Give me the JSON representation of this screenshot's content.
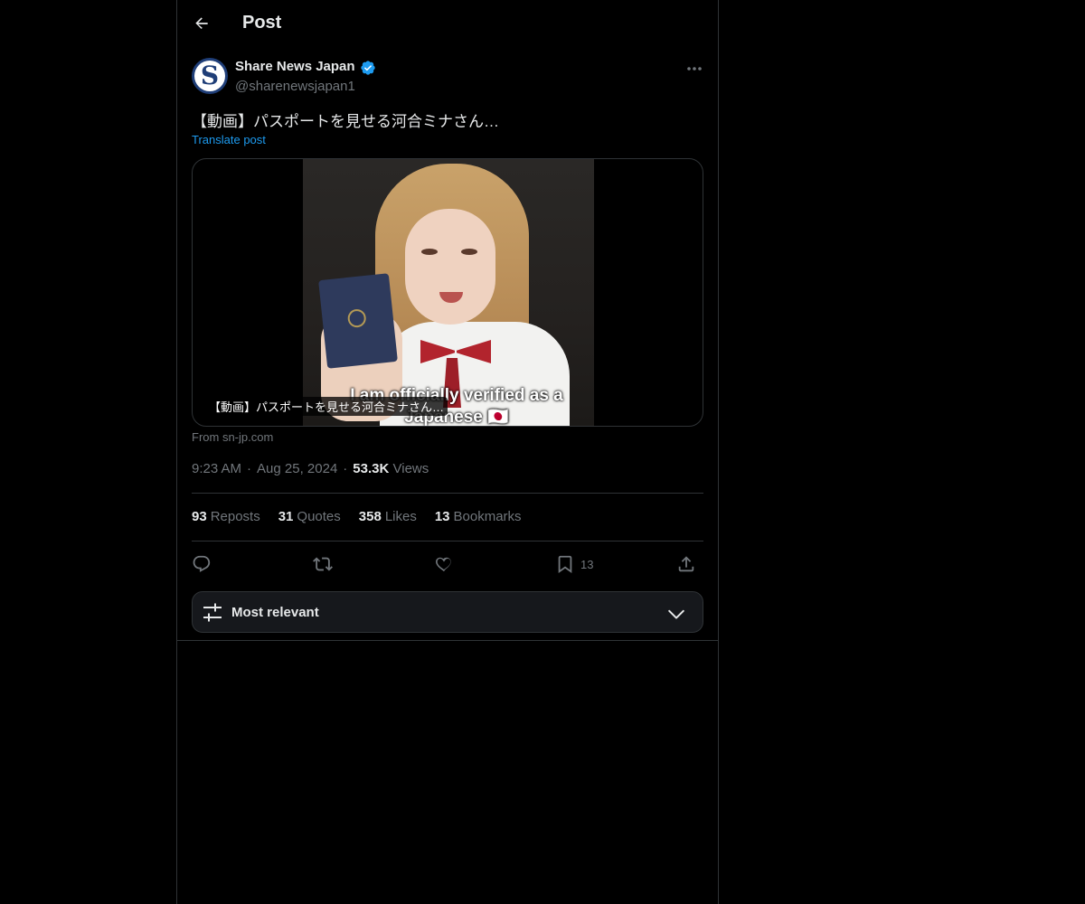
{
  "header": {
    "title": "Post",
    "back_icon": "arrow-left-icon"
  },
  "post": {
    "author": {
      "name": "Share News Japan",
      "handle": "@sharenewsjapan1",
      "avatar_letter": "S",
      "verified": true
    },
    "text": "【動画】パスポートを見せる河合ミナさん…",
    "translate_label": "Translate post",
    "media": {
      "caption": "【動画】パスポートを見せる河合ミナさん…",
      "subtitle": "I am officially verified as a Japanese 🇯🇵",
      "source": "From sn-jp.com"
    },
    "time": "9:23 AM",
    "date": "Aug 25, 2024",
    "views_count": "53.3K",
    "views_label": "Views"
  },
  "stats": {
    "reposts": {
      "count": "93",
      "label": "Reposts"
    },
    "quotes": {
      "count": "31",
      "label": "Quotes"
    },
    "likes": {
      "count": "358",
      "label": "Likes"
    },
    "bookmarks": {
      "count": "13",
      "label": "Bookmarks"
    }
  },
  "actions": {
    "bookmark_count": "13"
  },
  "sort": {
    "label": "Most relevant"
  },
  "colors": {
    "background": "#000000",
    "text": "#e7e9ea",
    "muted": "#71767b",
    "accent": "#1d9bf0",
    "border": "#2f3336"
  }
}
